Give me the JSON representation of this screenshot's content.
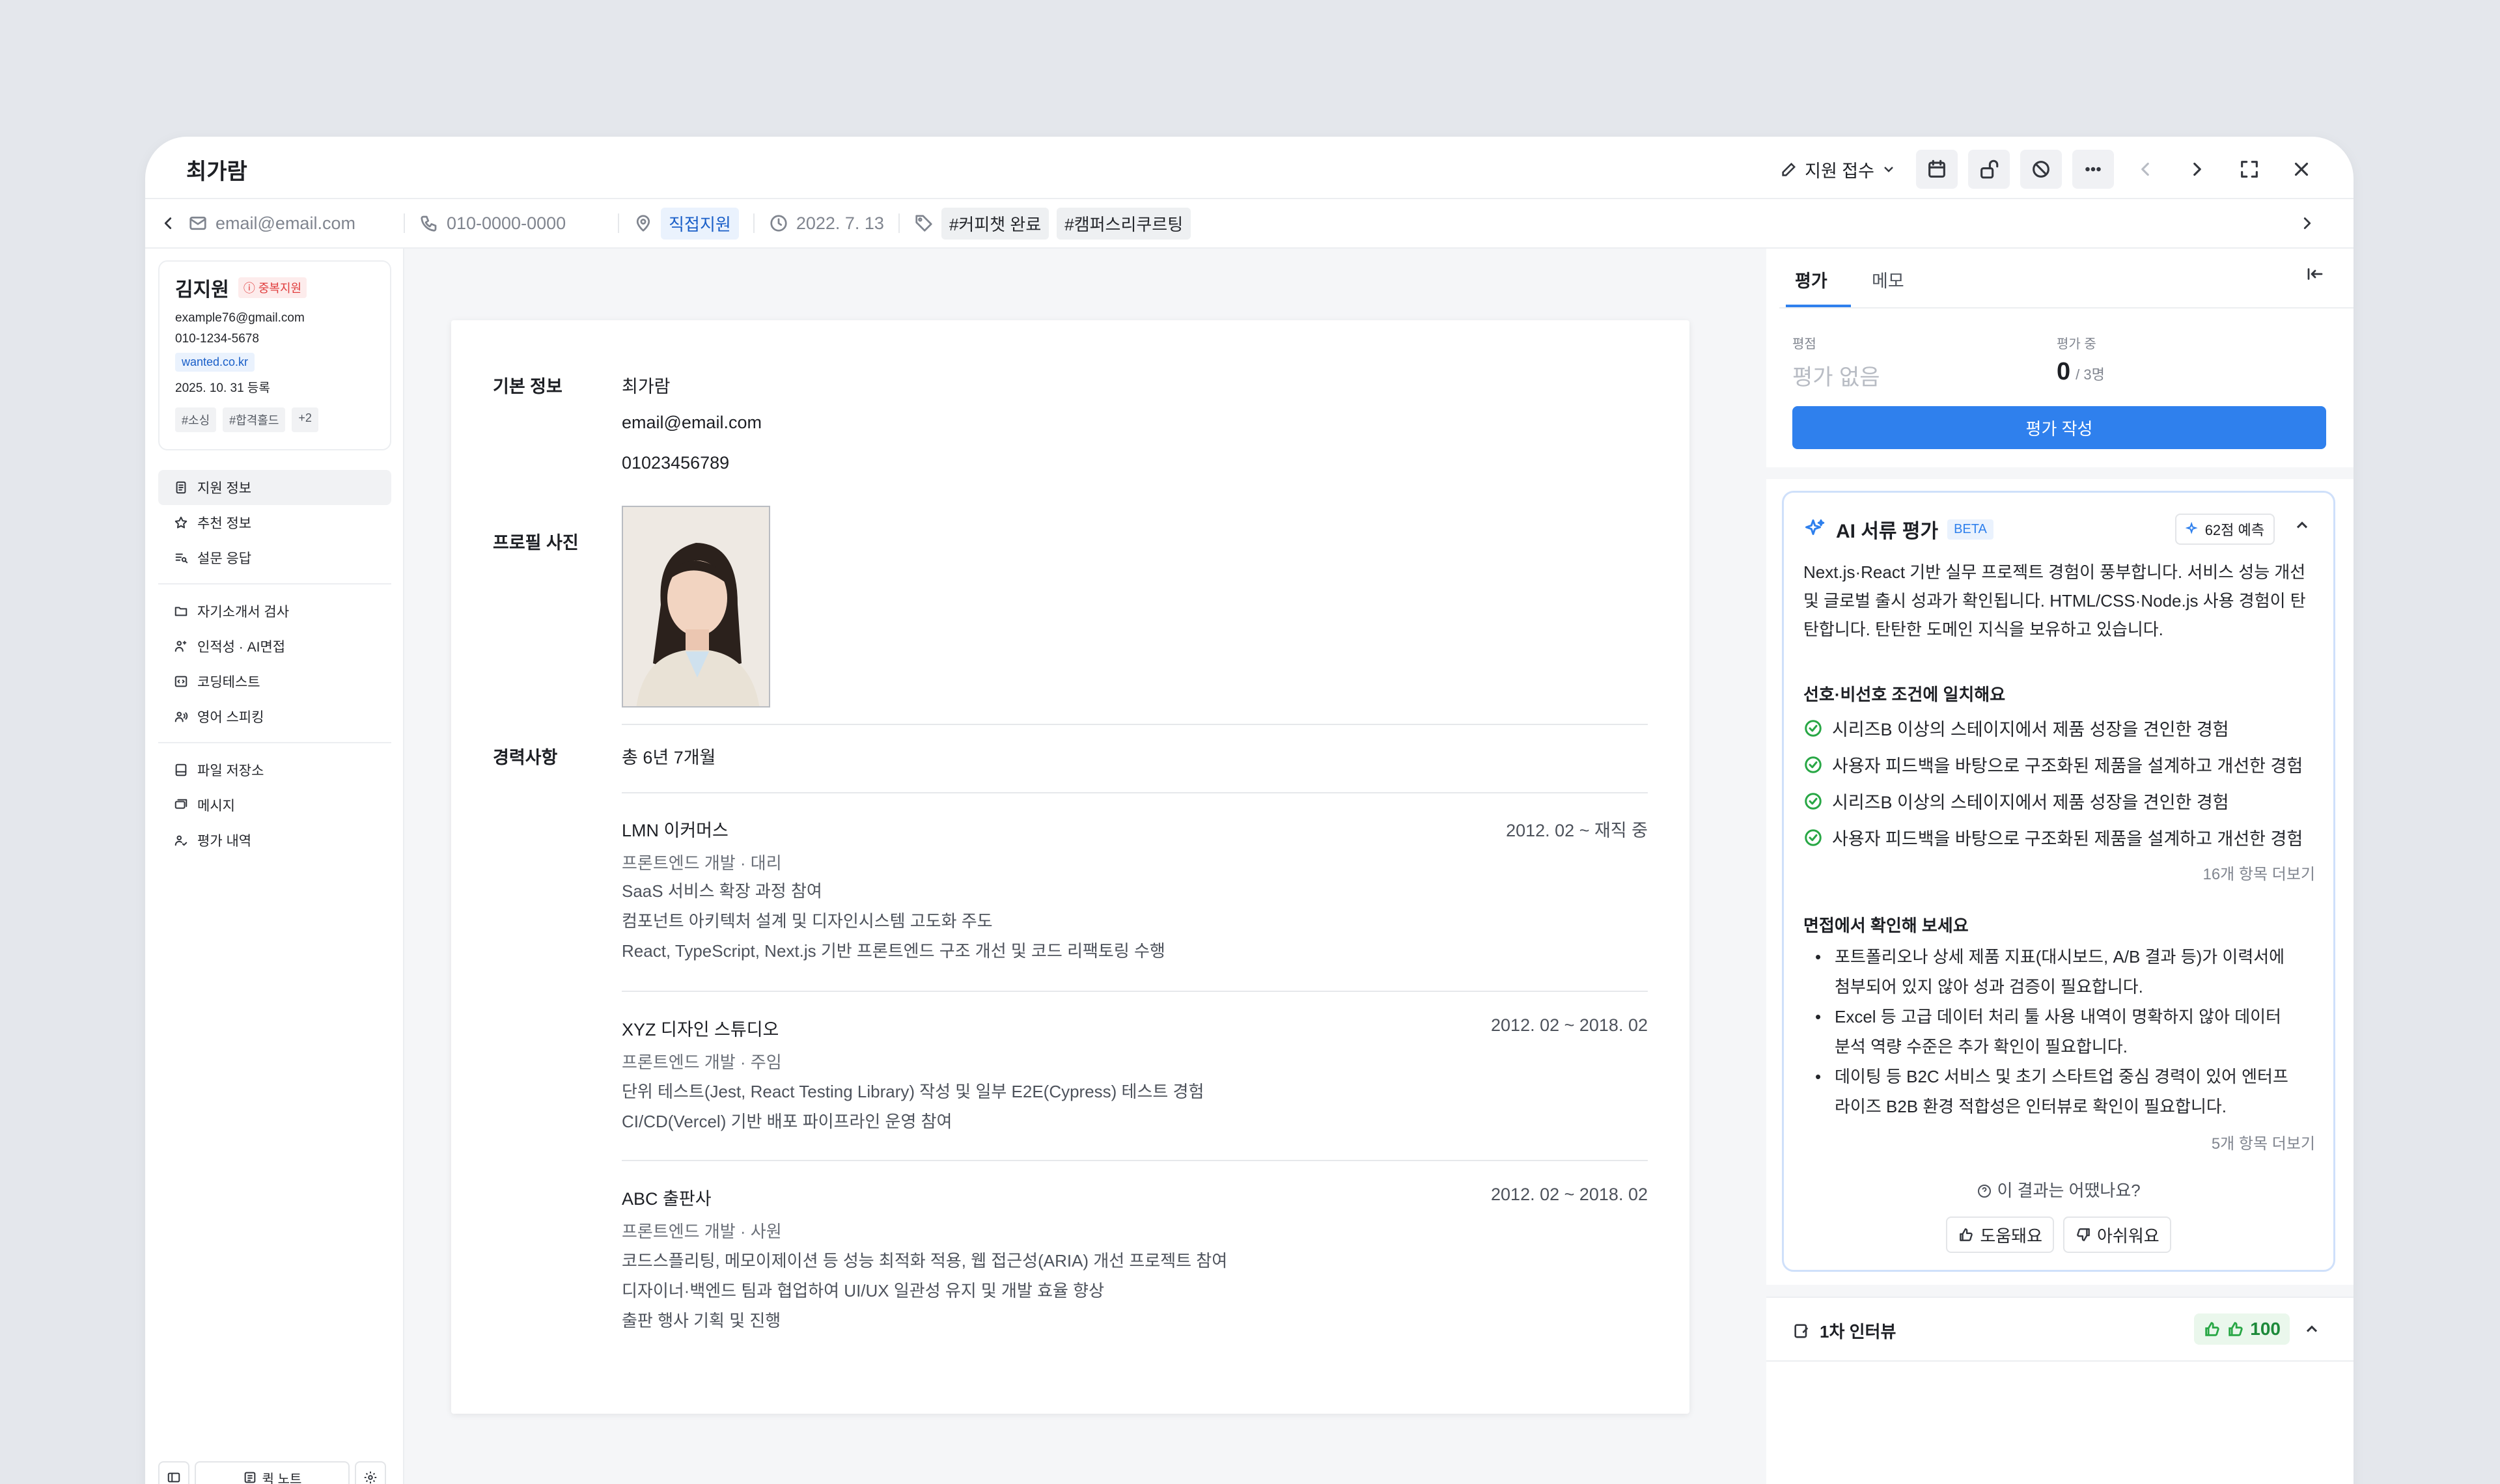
{
  "window": {
    "title": "최가람"
  },
  "toolbar": {
    "status_label": "지원 접수"
  },
  "infobar": {
    "email": "email@email.com",
    "phone": "010-0000-0000",
    "channel": "직접지원",
    "date": "2022. 7. 13",
    "tags": [
      "#커피챗 완료",
      "#캠퍼스리쿠르팅"
    ]
  },
  "candidate_card": {
    "name": "김지원",
    "duplicate_badge": "중복지원",
    "email": "example76@gmail.com",
    "phone": "010-1234-5678",
    "source": "wanted.co.kr",
    "registered": "2025. 10. 31 등록",
    "tags": [
      "#소싱",
      "#합격홀드",
      "+2"
    ]
  },
  "sidebar": {
    "group1": [
      "지원 정보",
      "추천 정보",
      "설문 응답"
    ],
    "group2": [
      "자기소개서 검사",
      "인적성 · AI면접",
      "코딩테스트",
      "영어 스피킹"
    ],
    "group3": [
      "파일 저장소",
      "메시지",
      "평가 내역"
    ],
    "quick_note": "퀵 노트"
  },
  "document": {
    "basic_label": "기본 정보",
    "name": "최가람",
    "email": "email@email.com",
    "phone": "01023456789",
    "photo_label": "프로필 사진",
    "career_label": "경력사항",
    "career_total": "총 6년 7개월",
    "careers": [
      {
        "company": "LMN 이커머스",
        "period": "2012. 02 ~ 재직 중",
        "role": "프론트엔드 개발 · 대리",
        "desc": [
          "SaaS 서비스 확장 과정 참여",
          "컴포넌트 아키텍처 설계 및 디자인시스템 고도화 주도",
          "React, TypeScript, Next.js 기반 프론트엔드 구조 개선 및 코드 리팩토링 수행"
        ]
      },
      {
        "company": "XYZ 디자인 스튜디오",
        "period": "2012. 02 ~ 2018. 02",
        "role": "프론트엔드 개발 · 주임",
        "desc": [
          "단위 테스트(Jest, React Testing Library) 작성 및 일부 E2E(Cypress) 테스트 경험",
          "CI/CD(Vercel) 기반 배포 파이프라인 운영 참여"
        ]
      },
      {
        "company": "ABC 출판사",
        "period": "2012. 02 ~ 2018. 02",
        "role": "프론트엔드 개발 · 사원",
        "desc": [
          "코드스플리팅, 메모이제이션 등 성능 최적화 적용, 웹 접근성(ARIA) 개선 프로젝트 참여",
          "디자이너·백엔드 팀과 협업하여 UI/UX 일관성 유지 및 개발 효율 향상",
          "출판 행사 기획 및 진행"
        ]
      }
    ]
  },
  "right": {
    "tabs": [
      "평가",
      "메모"
    ],
    "score_label": "평점",
    "score_value": "평가 없음",
    "progress_label": "평가 중",
    "progress_count": "0",
    "progress_total": "/ 3명",
    "eval_button": "평가 작성",
    "ai": {
      "title": "AI 서류 평가",
      "beta": "BETA",
      "prediction": "62점 예측",
      "summary": [
        "Next.js·React 기반 실무 프로젝트 경험이 풍부합니다. 서비스 성능 개선",
        "및 글로벌 출시 성과가 확인됩니다. HTML/CSS·Node.js 사용 경험이 탄",
        "탄합니다. 탄탄한 도메인 지식을 보유하고 있습니다."
      ],
      "match_title": "선호·비선호 조건에 일치해요",
      "matches": [
        "시리즈B 이상의 스테이지에서 제품 성장을 견인한 경험",
        "사용자 피드백을 바탕으로 구조화된 제품을 설계하고 개선한 경험",
        "시리즈B 이상의 스테이지에서 제품 성장을 견인한 경험",
        "사용자 피드백을 바탕으로 구조화된 제품을 설계하고 개선한 경험"
      ],
      "match_more": "16개 항목 더보기",
      "interview_title": "면접에서 확인해 보세요",
      "interview_points": [
        [
          "포트폴리오나 상세 제품 지표(대시보드, A/B 결과 등)가 이력서에",
          "첨부되어 있지 않아 성과 검증이 필요합니다."
        ],
        [
          "Excel 등 고급 데이터 처리 툴 사용 내역이 명확하지 않아 데이터",
          "분석 역량 수준은 추가 확인이 필요합니다."
        ],
        [
          "데이팅 등 B2C 서비스 및 초기 스타트업 중심 경력이 있어 엔터프",
          "라이즈 B2B 환경 적합성은 인터뷰로 확인이 필요합니다."
        ]
      ],
      "interview_more": "5개 항목 더보기",
      "feedback_question": "이 결과는 어땠나요?",
      "helpful": "도움돼요",
      "unhelpful": "아쉬워요"
    },
    "interview": {
      "title": "1차 인터뷰",
      "score": "100"
    }
  }
}
